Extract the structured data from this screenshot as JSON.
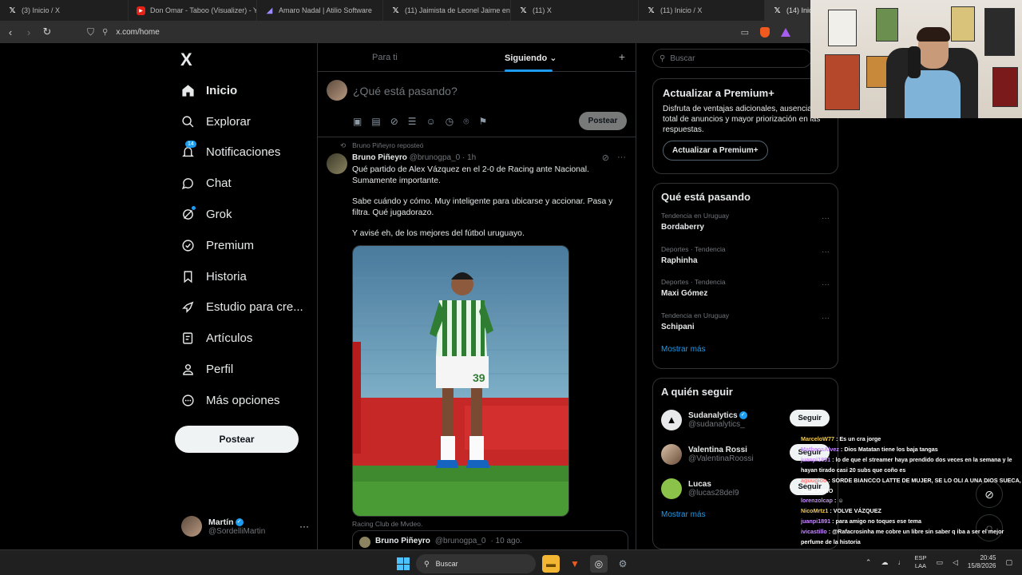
{
  "browser": {
    "tabs": [
      {
        "title": "(3) Inicio / X",
        "icon": "x-logo"
      },
      {
        "title": "Don Omar - Taboo (Visualizer) - You",
        "icon": "youtube-logo"
      },
      {
        "title": "Amaro Nadal | Atilio Software",
        "icon": "amaro-logo"
      },
      {
        "title": "(11) Jaimista de Leonel Jaime en X",
        "icon": "x-logo"
      },
      {
        "title": "(11) X",
        "icon": "x-logo"
      },
      {
        "title": "(11) Inicio / X",
        "icon": "x-logo"
      },
      {
        "title": "(14) Inici",
        "icon": "x-logo",
        "active": true
      }
    ],
    "url": "x.com/home"
  },
  "nav": {
    "logo": "X",
    "items": [
      {
        "label": "Inicio",
        "icon": "home-icon"
      },
      {
        "label": "Explorar",
        "icon": "search-icon"
      },
      {
        "label": "Notificaciones",
        "icon": "bell-icon",
        "badge": "14"
      },
      {
        "label": "Chat",
        "icon": "chat-icon"
      },
      {
        "label": "Grok",
        "icon": "grok-icon"
      },
      {
        "label": "Premium",
        "icon": "verified-icon"
      },
      {
        "label": "Historia",
        "icon": "bookmark-icon"
      },
      {
        "label": "Estudio para cre...",
        "icon": "rocket-icon"
      },
      {
        "label": "Artículos",
        "icon": "article-icon"
      },
      {
        "label": "Perfil",
        "icon": "person-icon"
      },
      {
        "label": "Más opciones",
        "icon": "more-icon"
      }
    ],
    "post_button": "Postear",
    "account": {
      "name": "Martín",
      "handle": "@SordelliMartin"
    }
  },
  "main": {
    "tabs": [
      "Para ti",
      "Siguiendo"
    ],
    "active_tab": "Siguiendo",
    "composer": {
      "placeholder": "¿Qué está pasando?",
      "post_button": "Postear"
    },
    "tweet": {
      "repost_label": "Bruno Piñeyro reposteó",
      "author": "Bruno Piñeyro",
      "handle": "@brunogpa_0",
      "time": "· 1h",
      "text": [
        "Qué partido de Alex Vázquez en el 2-0 de Racing ante Nacional. Sumamente importante.",
        "Sabe cuándo y cómo. Muy inteligente para ubicarse y accionar. Pasa y filtra. Qué jugadorazo.",
        "Y avisé eh, de los mejores del fútbol uruguayo."
      ],
      "media_caption": "Racing Club de Mvdeo.",
      "shirt_number": "39",
      "quoted": {
        "author": "Bruno Piñeyro",
        "handle": "@brunogpa_0",
        "time": "· 10 ago."
      }
    }
  },
  "right": {
    "search_placeholder": "Buscar",
    "premium": {
      "title": "Actualizar a Premium+",
      "description": "Disfruta de ventajas adicionales, ausencia total de anuncios y mayor priorización en las respuestas.",
      "button": "Actualizar a Premium+"
    },
    "trends": {
      "title": "Qué está pasando",
      "items": [
        {
          "context": "Tendencia en Uruguay",
          "name": "Bordaberry"
        },
        {
          "context": "Deportes · Tendencia",
          "name": "Raphinha"
        },
        {
          "context": "Deportes · Tendencia",
          "name": "Maxi Gómez"
        },
        {
          "context": "Tendencia en Uruguay",
          "name": "Schipani"
        }
      ],
      "show_more": "Mostrar más"
    },
    "who_to_follow": {
      "title": "A quién seguir",
      "items": [
        {
          "name": "Sudanalytics",
          "handle": "@sudanalytics_",
          "verified": true,
          "button": "Seguir"
        },
        {
          "name": "Valentina Rossi",
          "handle": "@ValentinaRoossi",
          "verified": false,
          "button": "Seguir"
        },
        {
          "name": "Lucas",
          "handle": "@lucas28del9",
          "verified": false,
          "button": "Seguir"
        }
      ],
      "show_more": "Mostrar más"
    }
  },
  "stream_chat": [
    {
      "user": "MarceloW77",
      "text": "Es un cra jorge"
    },
    {
      "user": "MatheosAlvez",
      "text": "Dios Matatan tiene los baja tangas"
    },
    {
      "user": "juanpi1891",
      "text": "lo de que el streamer haya prendido dos veces en la semana y le hayan tirado casi 20 subs que coño es"
    },
    {
      "user": "aguugioo",
      "text": "SORDE BIANCCO LATTE DE MUJER, SE LO OLI A UNA DIOS SUECA, SUBLIMINO"
    },
    {
      "user": "lorenzolcap",
      "text": "☺"
    },
    {
      "user": "NicoMrtz1",
      "text": "VOLVE VÁZQUEZ"
    },
    {
      "user": "juanpi1891",
      "text": "para amigo no toques ese tema"
    },
    {
      "user": "ivicastillo",
      "text": "@Rafacrosinha me cobre un libre sin saber q iba a ser el mejor perfume de la historia"
    }
  ],
  "taskbar": {
    "search": "Buscar",
    "lang": "ESP",
    "lang2": "LAA",
    "time": "20:45",
    "date": "15/8/2026"
  },
  "colors": {
    "accent": "#1d9bf0",
    "background": "#000000",
    "text": "#e7e9ea",
    "muted": "#71767b"
  }
}
